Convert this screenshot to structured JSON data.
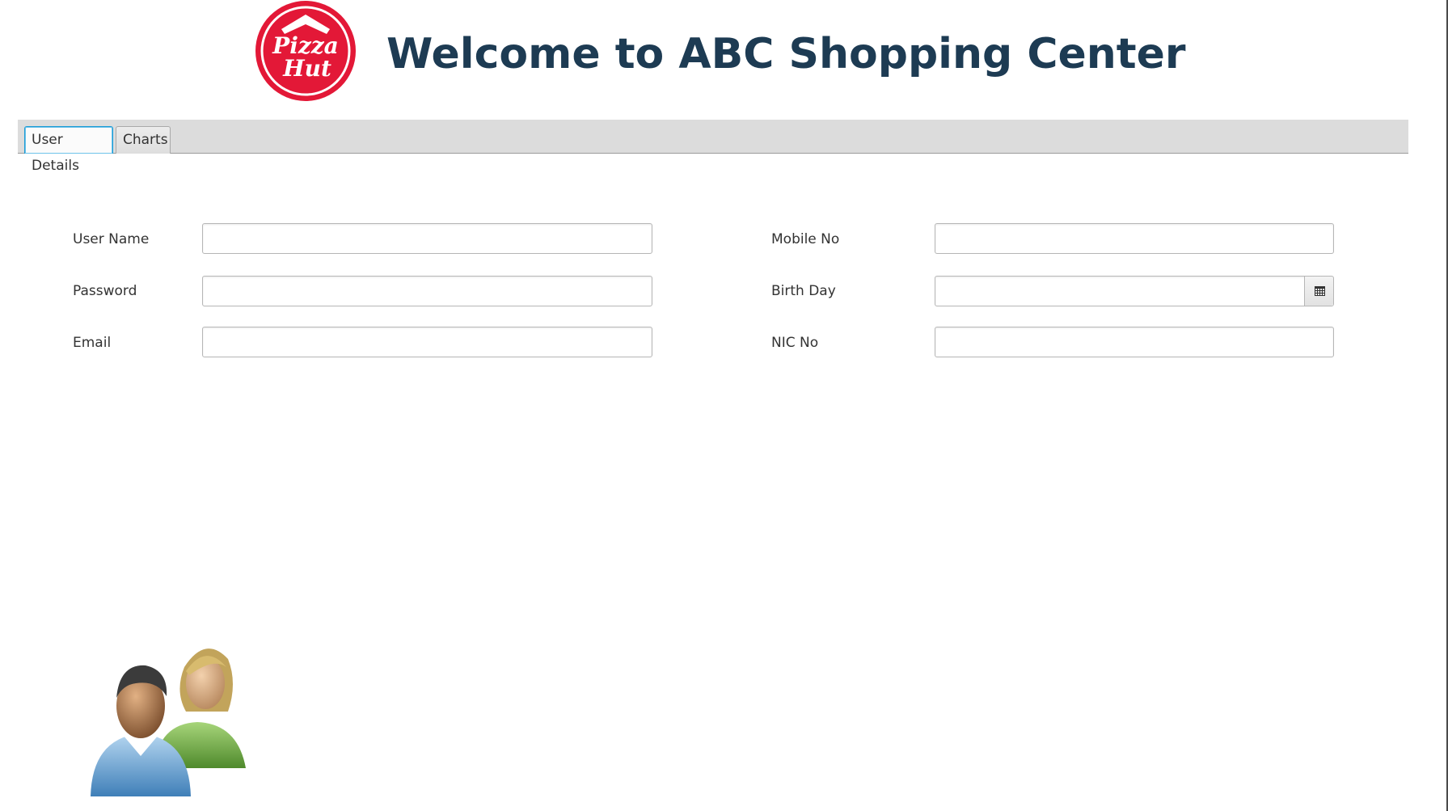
{
  "header": {
    "logo_text": "Pizza Hut",
    "title": "Welcome to ABC Shopping Center"
  },
  "tabs": [
    {
      "label": "User Details",
      "active": true
    },
    {
      "label": "Charts",
      "active": false
    }
  ],
  "form": {
    "user_name_label": "User Name",
    "password_label": "Password",
    "email_label": "Email",
    "mobile_label": "Mobile No",
    "birthday_label": "Birth Day",
    "nic_label": "NIC No",
    "user_name_value": "",
    "password_value": "",
    "email_value": "",
    "mobile_value": "",
    "birthday_value": "",
    "nic_value": ""
  },
  "icons": {
    "calendar": "calendar-icon",
    "users": "users-icon"
  },
  "colors": {
    "title": "#1d3b53",
    "brand_red": "#e31837",
    "tab_accent": "#1a9bd6"
  }
}
